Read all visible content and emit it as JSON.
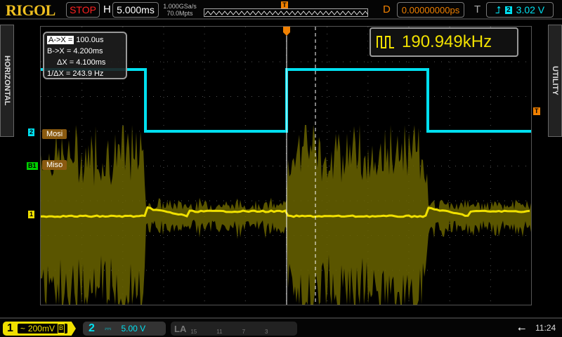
{
  "top": {
    "brand": "RIGOL",
    "run_state": "STOP",
    "h_label": "H",
    "timebase": "5.000ms",
    "sample_rate": "1.000GSa/s",
    "memory_depth": "70.0Mpts",
    "d_label": "D",
    "delay": "0.00000000ps",
    "t_label": "T",
    "trigger_channel": "2",
    "trigger_level": "3.02 V"
  },
  "side": {
    "left_tab": "HORIZONTAL",
    "right_tab": "UTILITY"
  },
  "cursor_box": {
    "rows": [
      {
        "label": "A->X =",
        "value": "100.0us"
      },
      {
        "label": "B->X =",
        "value": "4.200ms"
      },
      {
        "label": "ΔX =",
        "value": "4.100ms"
      },
      {
        "label": "1/ΔX =",
        "value": "243.9 Hz"
      }
    ]
  },
  "frequency_counter": {
    "value": "190.949kHz"
  },
  "markers": {
    "ch2": "2",
    "b1": "B1",
    "ch1": "1",
    "trigger": "T",
    "trigger_pos": "T"
  },
  "labels": {
    "mosi": "Mosi",
    "miso": "Miso"
  },
  "bottom": {
    "ch1_num": "1",
    "ch1_coupling": "~",
    "ch1_scale": "200mV",
    "ch1_bw": "B",
    "ch2_num": "2",
    "ch2_coupling": "⎓",
    "ch2_scale": "5.00 V",
    "la_label": "LA",
    "la_ticks": [
      "15",
      "11",
      "7",
      "3"
    ],
    "time": "11:24"
  },
  "colors": {
    "ch1": "#f0e000",
    "ch2": "#00e0f0",
    "b1": "#00d000",
    "trigger": "#f08000",
    "stop": "#ff2020"
  }
}
